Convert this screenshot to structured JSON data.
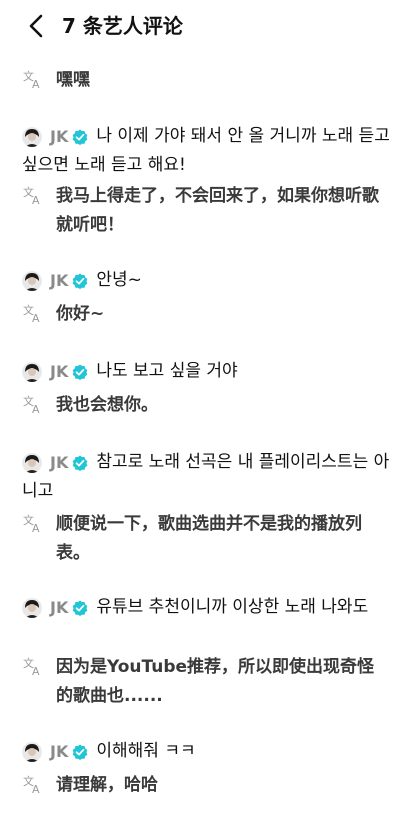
{
  "header": {
    "title": "7 条艺人评论"
  },
  "top_partial": {
    "translation": "嘿嘿"
  },
  "comments": [
    {
      "author": "JK",
      "text": "나 이제 가야 돼서 안 올 거니까 노래 듣고 싶으면 노래 듣고 해요!",
      "translation": "我马上得走了，不会回来了，如果你想听歌就听吧！"
    },
    {
      "author": "JK",
      "text": "안녕~",
      "translation": "你好~"
    },
    {
      "author": "JK",
      "text": "나도 보고 싶을 거야",
      "translation": "我也会想你。"
    },
    {
      "author": "JK",
      "text": "참고로 노래 선곡은 내 플레이리스트는 아니고",
      "translation": "顺便说一下，歌曲选曲并不是我的播放列表。"
    },
    {
      "author": "JK",
      "text": "유튜브 추천이니까 이상한 노래 나와도",
      "translation": "因为是YouTube推荐，所以即使出现奇怪的歌曲也......"
    },
    {
      "author": "JK",
      "text": "이해해줘 ㅋㅋ",
      "translation": "请理解，哈哈"
    }
  ],
  "icons": {
    "back": "chevron-left-icon",
    "translate": "translate-icon",
    "verified": "verified-badge-icon"
  },
  "colors": {
    "verified": "#20C5D6",
    "author": "#8a8a8a",
    "translation": "#3a3a3a"
  }
}
